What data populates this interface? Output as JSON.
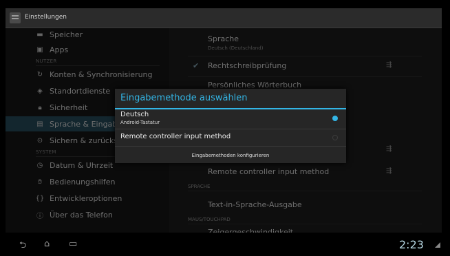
{
  "title_bar": {
    "title": "Einstellungen"
  },
  "left_menu": {
    "items": [
      {
        "label": "Speicher",
        "icon": "storage-icon"
      },
      {
        "label": "Apps",
        "icon": "apps-icon"
      },
      {
        "label": "NUTZER",
        "type": "header"
      },
      {
        "label": "Konten & Synchronisierung",
        "icon": "sync-icon"
      },
      {
        "label": "Standortdienste",
        "icon": "location-icon"
      },
      {
        "label": "Sicherheit",
        "icon": "lock-icon"
      },
      {
        "label": "Sprache & Eingabe",
        "icon": "keyboard-icon",
        "selected": true
      },
      {
        "label": "Sichern & zurücksetzen",
        "icon": "backup-icon"
      },
      {
        "label": "SYSTEM",
        "type": "header"
      },
      {
        "label": "Datum & Uhrzeit",
        "icon": "clock-icon"
      },
      {
        "label": "Bedienungshilfen",
        "icon": "accessibility-icon"
      },
      {
        "label": "Entwickleroptionen",
        "icon": "developer-icon"
      },
      {
        "label": "Über das Telefon",
        "icon": "info-icon"
      }
    ]
  },
  "right_pane": {
    "language_title": "Sprache",
    "language_value": "Deutsch (Deutschland)",
    "spellcheck_label": "Rechtschreibprüfung",
    "partial_item": "Persönliches Wörterbuch",
    "remote_controller_label": "Remote controller input method",
    "sprache_header": "SPRACHE",
    "tts_label": "Text-in-Sprache-Ausgabe",
    "mouse_header": "MAUS/TOUCHPAD",
    "pointer_speed_label": "Zeigergeschwindigkeit"
  },
  "dialog": {
    "title": "Eingabemethode auswählen",
    "options": [
      {
        "label": "Deutsch",
        "sublabel": "Android-Tastatur",
        "selected": true
      },
      {
        "label": "Remote controller input method",
        "selected": false
      }
    ],
    "configure_label": "Eingabemethoden konfigurieren"
  },
  "nav_bar": {
    "clock": "2:23"
  },
  "colors": {
    "accent": "#33b5e5",
    "background": "#101010"
  }
}
